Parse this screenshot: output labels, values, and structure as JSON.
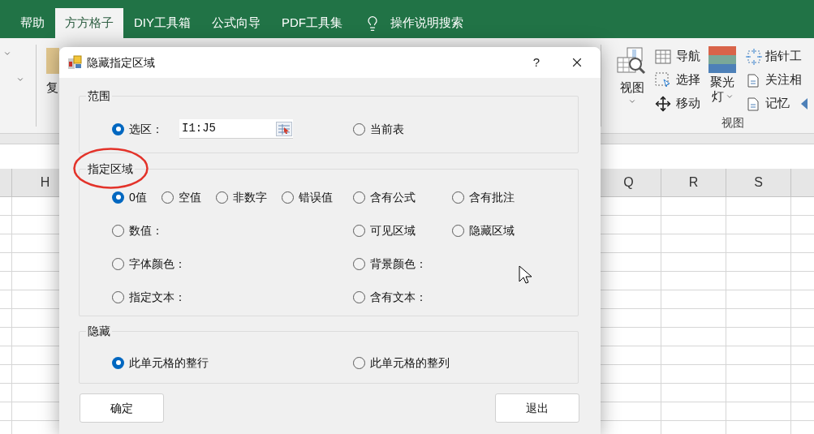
{
  "ribbon": {
    "tabs": [
      {
        "label": "帮助",
        "selected": false
      },
      {
        "label": "方方格子",
        "selected": true
      },
      {
        "label": "DIY工具箱",
        "selected": false
      },
      {
        "label": "公式向导",
        "selected": false
      },
      {
        "label": "PDF工具集",
        "selected": false
      }
    ],
    "search": {
      "label": "操作说明搜索"
    },
    "left_fragment": {
      "label": "复"
    },
    "view_group": {
      "big_button": "视图",
      "nav_items": [
        "导航",
        "选择",
        "移动"
      ],
      "spotlight": {
        "line1": "聚光",
        "line2": "灯"
      },
      "more_items": [
        "指针工",
        "关注相",
        "记忆"
      ],
      "group_label": "视图"
    }
  },
  "sheet": {
    "columns_left": [
      "H"
    ],
    "columns_right": [
      "Q",
      "R",
      "S"
    ]
  },
  "dialog": {
    "title": "隐藏指定区域",
    "help": "?",
    "range_group": {
      "legend": "范围",
      "rows": [
        {
          "left": [
            {
              "label": "选区：",
              "selected": true,
              "value": "I1:J5"
            }
          ],
          "right": [
            {
              "label": "当前表",
              "selected": false
            }
          ]
        }
      ]
    },
    "area_group": {
      "legend": "指定区域",
      "rows": [
        {
          "left": [
            {
              "label": "0值",
              "selected": true
            },
            {
              "label": "空值",
              "selected": false
            },
            {
              "label": "非数字",
              "selected": false
            },
            {
              "label": "错误值",
              "selected": false
            }
          ],
          "right": [
            {
              "label": "含有公式",
              "selected": false
            },
            {
              "label": "含有批注",
              "selected": false
            }
          ]
        },
        {
          "left": [
            {
              "label": "数值：",
              "selected": false
            }
          ],
          "right": [
            {
              "label": "可见区域",
              "selected": false
            },
            {
              "label": "隐藏区域",
              "selected": false
            }
          ]
        },
        {
          "left": [
            {
              "label": "字体颜色：",
              "selected": false
            }
          ],
          "right": [
            {
              "label": "背景颜色：",
              "selected": false
            }
          ]
        },
        {
          "left": [
            {
              "label": "指定文本：",
              "selected": false
            }
          ],
          "right": [
            {
              "label": "含有文本：",
              "selected": false
            }
          ]
        }
      ]
    },
    "hide_group": {
      "legend": "隐藏",
      "rows": [
        {
          "left": [
            {
              "label": "此单元格的整行",
              "selected": true
            }
          ],
          "right": [
            {
              "label": "此单元格的整列",
              "selected": false
            }
          ]
        }
      ]
    },
    "buttons": [
      "确定",
      "退出"
    ]
  }
}
